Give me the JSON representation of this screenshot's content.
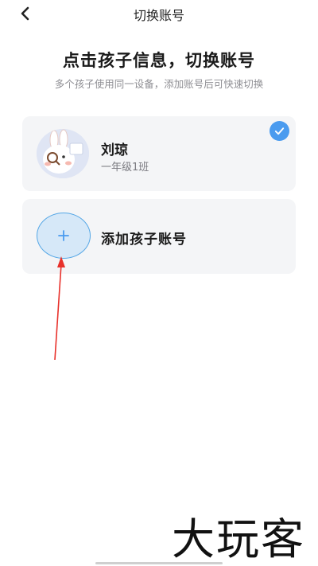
{
  "nav": {
    "title": "切换账号",
    "back_icon": "chevron-left-icon"
  },
  "header": {
    "headline": "点击孩子信息，切换账号",
    "subline": "多个孩子使用同一设备，添加账号后可快速切换"
  },
  "accounts": [
    {
      "name": "刘琼",
      "class": "一年级1班",
      "selected": true,
      "avatar_icon": "cartoon-rabbit-avatar-icon"
    }
  ],
  "add_account": {
    "label": "添加孩子账号",
    "icon": "plus-icon"
  },
  "watermark": {
    "text": "大玩客"
  },
  "colors": {
    "accent": "#4a9bef",
    "card_bg": "#f4f5f7",
    "annotation_arrow": "#e8312b"
  }
}
